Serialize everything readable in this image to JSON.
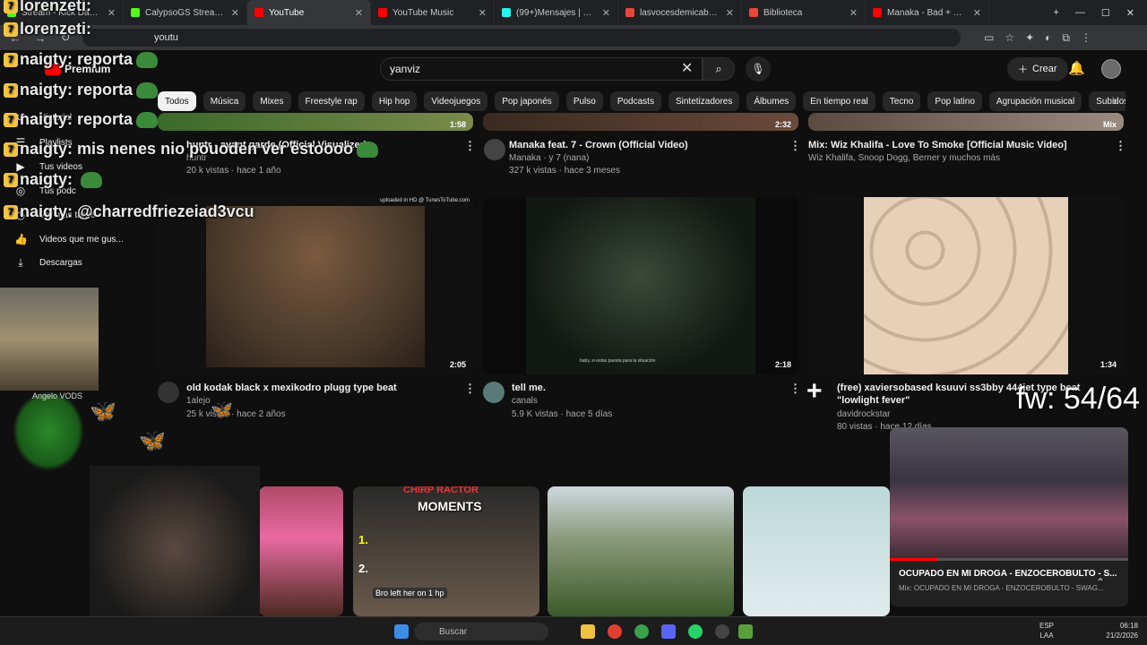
{
  "browser": {
    "tabs": [
      {
        "title": "Stream - Kick Dashboard",
        "color": "#53fc18"
      },
      {
        "title": "CalypsoGS Stream - Watc",
        "color": "#53fc18"
      },
      {
        "title": "YouTube",
        "color": "#ff0000",
        "active": true
      },
      {
        "title": "YouTube Music",
        "color": "#ff0000"
      },
      {
        "title": "(99+)Mensajes | TikTok",
        "color": "#25f4ee"
      },
      {
        "title": "lasvocesdemicabeza por e",
        "color": "#e9463a"
      },
      {
        "title": "Biblioteca",
        "color": "#e9463a"
      },
      {
        "title": "Manaka - Bad + Sad Boi",
        "color": "#ff0000"
      }
    ],
    "url": "youtu"
  },
  "masthead": {
    "logo_label": "Premium",
    "search_value": "yanviz",
    "create_label": "Crear"
  },
  "chips": [
    "Todos",
    "Música",
    "Mixes",
    "Freestyle rap",
    "Hip hop",
    "Videojuegos",
    "Pop japonés",
    "Pulso",
    "Podcasts",
    "Sintetizadores",
    "Álbumes",
    "En tiempo real",
    "Tecno",
    "Pop latino",
    "Agrupación musical",
    "Subidos recie"
  ],
  "sidebar": {
    "items": [
      {
        "label": "Historial",
        "icon": "history-icon",
        "glyph": "↺"
      },
      {
        "label": "Playlists",
        "icon": "playlist-icon",
        "glyph": "☰"
      },
      {
        "label": "Tus videos",
        "icon": "video-icon",
        "glyph": "▶"
      },
      {
        "label": "Tus podc",
        "icon": "podcast-icon",
        "glyph": "◎"
      },
      {
        "label": "Ver más tarde",
        "icon": "clock-icon",
        "glyph": "◷"
      },
      {
        "label": "Videos que me gus...",
        "icon": "like-icon",
        "glyph": "👍"
      },
      {
        "label": "Descargas",
        "icon": "download-icon",
        "glyph": "⤓"
      }
    ],
    "subscription": "Angelo VODS"
  },
  "videos_row1": [
    {
      "title": "huntr - avant garde (Official Visualizer)",
      "channel": "huntr",
      "meta": "20 k vistas · hace 1 año",
      "duration": "1:58"
    },
    {
      "title": "Manaka feat. 7 - Crown (Official Video)",
      "channel": "Manaka · y 7 (nana)",
      "meta": "327 k vistas · hace 3 meses",
      "duration": "2:32"
    },
    {
      "title": "Mix: Wiz Khalifa - Love To Smoke [Official Music Video]",
      "channel": "Wiz Khalifa, Snoop Dogg, Berner y muchos más",
      "meta": "",
      "duration": "Mix"
    }
  ],
  "videos_row2": [
    {
      "title": "old kodak black x mexikodro plugg type beat",
      "channel": "1alejo",
      "meta": "25 k vistas · hace 2 años",
      "duration": "2:05",
      "watermark": "uploaded in HD @ TunesToTube.com"
    },
    {
      "title": "tell me.",
      "channel": "canals",
      "meta": "5.9 K vistas · hace 5 días",
      "duration": "2:18",
      "subtitle": "baby, si estas puesta para la situación"
    },
    {
      "title": "(free) xaviersobased ksuuvi ss3bby 444jet type beat \"lowlight fever\"",
      "channel": "davidrockstar",
      "meta": "80 vistas · hace 12 días",
      "duration": "1:34"
    }
  ],
  "shorts": [
    {
      "caption": ""
    },
    {
      "caption": "MOMENTS",
      "header": "CHIRP RACTOR",
      "list": [
        "1.",
        "2."
      ],
      "speech": "Bro left her on 1 hp"
    },
    {
      "caption": ""
    },
    {
      "caption": ""
    }
  ],
  "overlay": {
    "chat": [
      {
        "user": "lorenzeti:",
        "msg": ""
      },
      {
        "user": "lorenzeti:",
        "msg": ""
      },
      {
        "user": "naigty:",
        "msg": "reporta"
      },
      {
        "user": "naigty:",
        "msg": "reporta"
      },
      {
        "user": "naigty:",
        "msg": "reporta"
      },
      {
        "user": "naigty:",
        "msg": "mis nenes nio pouoden ver estoooo"
      },
      {
        "user": "naigty:",
        "msg": ""
      },
      {
        "user": "naigty:",
        "msg": "@charredfriezeiad3vcu"
      }
    ],
    "fw": "fw: 54/64"
  },
  "miniplayer": {
    "title": "OCUPADO EN MI DROGA - ENZOCEROBULTO - S...",
    "subtitle": "Mix: OCUPADO EN MI DROGA - ENZOCEROBULTO - SWAG...",
    "progress": 0.2
  },
  "taskbar": {
    "search": "Buscar",
    "lang": "ESP",
    "region": "LAA",
    "time": "06:18",
    "date": "21/2/2026"
  },
  "colors": {
    "accent": "#ff0000",
    "bg": "#0f0f0f",
    "kick": "#53fc18"
  }
}
